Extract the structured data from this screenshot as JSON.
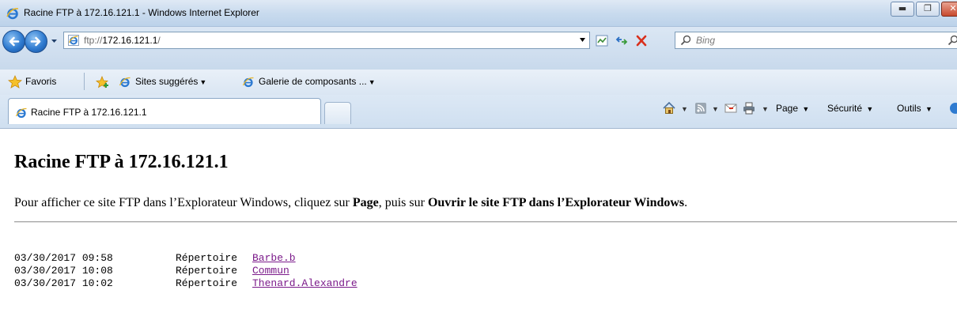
{
  "window": {
    "title": "Racine FTP à 172.16.121.1 - Windows Internet Explorer",
    "min_glyph": "▬",
    "max_glyph": "❐",
    "close_glyph": "✕"
  },
  "address_bar": {
    "url_prefix": "ftp://",
    "url_host": "172.16.121.1",
    "url_suffix": "/"
  },
  "search": {
    "placeholder": "Bing"
  },
  "favorites_bar": {
    "favorites_label": "Favoris",
    "suggested_sites_label": "Sites suggérés",
    "gallery_label": "Galerie de composants ..."
  },
  "tab": {
    "label": "Racine FTP à 172.16.121.1"
  },
  "command_bar": {
    "page_label": "Page",
    "security_label": "Sécurité",
    "tools_label": "Outils"
  },
  "content": {
    "heading": "Racine FTP à 172.16.121.1",
    "instruction_prefix": "Pour afficher ce site FTP dans l’Explorateur Windows, cliquez sur ",
    "instruction_page": "Page",
    "instruction_middle": ", puis sur ",
    "instruction_action": "Ouvrir le site FTP dans l’Explorateur Windows",
    "instruction_end": ".",
    "entries": [
      {
        "date": "03/30/2017",
        "time": "09:58",
        "datetime": "03/30/2017 09:58",
        "type": "Répertoire",
        "name": "Barbe.b"
      },
      {
        "date": "03/30/2017",
        "time": "10:08",
        "datetime": "03/30/2017 10:08",
        "type": "Répertoire",
        "name": "Commun"
      },
      {
        "date": "03/30/2017",
        "time": "10:02",
        "datetime": "03/30/2017 10:02",
        "type": "Répertoire",
        "name": "Thenard.Alexandre"
      }
    ]
  },
  "colors": {
    "visited_link": "#7b1a8a",
    "chrome_blue": "#c9dbee",
    "close_red": "#c7492e"
  },
  "icons": [
    "ie-logo-icon",
    "back-arrow-icon",
    "forward-arrow-icon",
    "compatibility-view-icon",
    "refresh-icon",
    "stop-icon",
    "search-icon",
    "favorites-star-icon",
    "add-favorites-icon",
    "home-icon",
    "rss-feed-icon",
    "read-mail-icon",
    "print-icon"
  ]
}
